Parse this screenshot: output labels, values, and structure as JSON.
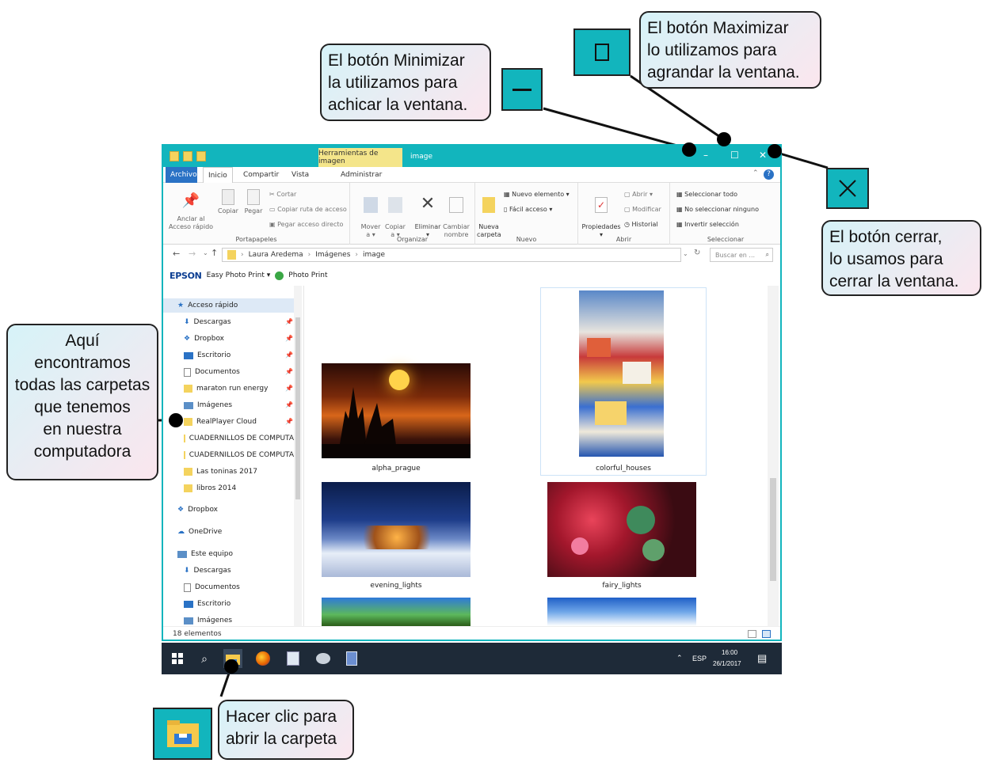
{
  "callouts": {
    "minimize": "El botón Minimizar\nla utilizamos para\nachicar la ventana.",
    "maximize": "El botón Maximizar\nlo utilizamos para\nagrandar la ventana.",
    "close": "El botón cerrar,\nlo usamos para\ncerrar la ventana.",
    "folders": "Aquí\nencontramos\ntodas las carpetas\nque tenemos\nen nuestra\ncomputadora",
    "taskbar": "Hacer clic para\nabrir la carpeta"
  },
  "window": {
    "context_tab": "Herramientas de imagen",
    "title": "image",
    "minimize_glyph": "–",
    "maximize_glyph": "☐",
    "close_glyph": "✕"
  },
  "ribbon_tabs": {
    "file": "Archivo",
    "home": "Inicio",
    "share": "Compartir",
    "view": "Vista",
    "manage": "Administrar"
  },
  "ribbon": {
    "pin": "Anclar al\nAcceso rápido",
    "copy": "Copiar",
    "paste": "Pegar",
    "cut": "Cortar",
    "copy_path": "Copiar ruta de acceso",
    "paste_shortcut": "Pegar acceso directo",
    "group_clipboard": "Portapapeles",
    "move_to": "Mover\na ▾",
    "copy_to": "Copiar\na ▾",
    "delete": "Eliminar\n▾",
    "rename": "Cambiar\nnombre",
    "group_organize": "Organizar",
    "new_folder": "Nueva\ncarpeta",
    "new_item": "Nuevo elemento ▾",
    "easy_access": "Fácil acceso ▾",
    "group_new": "Nuevo",
    "properties": "Propiedades\n▾",
    "open": "Abrir ▾",
    "edit": "Modificar",
    "history": "Historial",
    "group_open": "Abrir",
    "select_all": "Seleccionar todo",
    "select_none": "No seleccionar ninguno",
    "invert": "Invertir selección",
    "group_select": "Seleccionar"
  },
  "address": {
    "crumbs": [
      "Laura Aredema",
      "Imágenes",
      "image"
    ],
    "search_placeholder": "Buscar en ... "
  },
  "epson": {
    "brand": "EPSON",
    "app": "Easy Photo Print ▾",
    "photo": "Photo Print"
  },
  "nav": {
    "quick_access": "Acceso rápido",
    "items": [
      "Descargas",
      "Dropbox",
      "Escritorio",
      "Documentos",
      "maraton run energy",
      "Imágenes",
      "RealPlayer Cloud",
      "CUADERNILLOS DE COMPUTA",
      "CUADERNILLOS DE COMPUTA",
      "Las toninas 2017",
      "libros 2014"
    ],
    "dropbox": "Dropbox",
    "onedrive": "OneDrive",
    "this_pc": "Este equipo",
    "pc_items": [
      "Descargas",
      "Documentos",
      "Escritorio",
      "Imágenes"
    ]
  },
  "files": [
    "alpha_prague",
    "colorful_houses",
    "evening_lights",
    "fairy_lights"
  ],
  "status": "18 elementos",
  "taskbar": {
    "lang": "ESP",
    "time": "16:00",
    "date": "26/1/2017"
  },
  "colors": {
    "accent": "#12b5bd",
    "taskbar": "#1e2a38"
  }
}
